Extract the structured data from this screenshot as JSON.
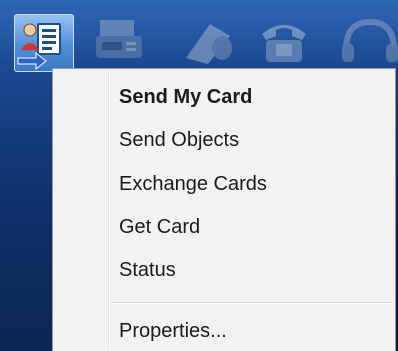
{
  "tray": {
    "icons": [
      "bluetooth-card-icon",
      "fax-machine-icon",
      "document-scanner-icon",
      "telephone-icon",
      "headset-icon"
    ]
  },
  "menu": {
    "items": [
      {
        "label": "Send My Card",
        "default": true
      },
      {
        "label": "Send Objects",
        "default": false
      },
      {
        "label": "Exchange Cards",
        "default": false
      },
      {
        "label": "Get Card",
        "default": false
      },
      {
        "label": "Status",
        "default": false
      },
      {
        "label": "Properties...",
        "default": false
      }
    ]
  }
}
